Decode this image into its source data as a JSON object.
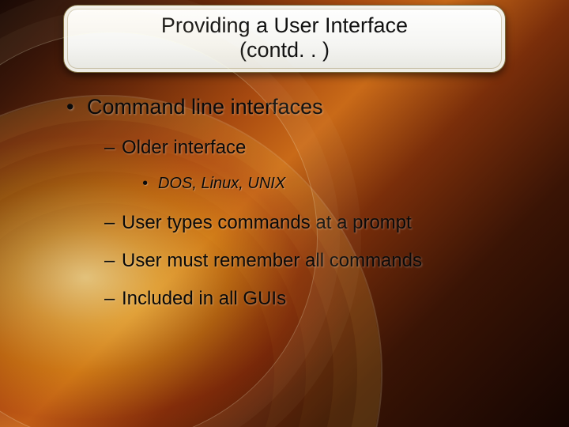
{
  "title": {
    "line1": "Providing a User Interface",
    "line2": "(contd. . )"
  },
  "bullets": {
    "b1": "Command line interfaces",
    "b1_1": "Older interface",
    "b1_1_1": "DOS, Linux, UNIX",
    "b1_2": "User types commands at a prompt",
    "b1_3": "User must remember all commands",
    "b1_4": "Included in all GUIs"
  }
}
